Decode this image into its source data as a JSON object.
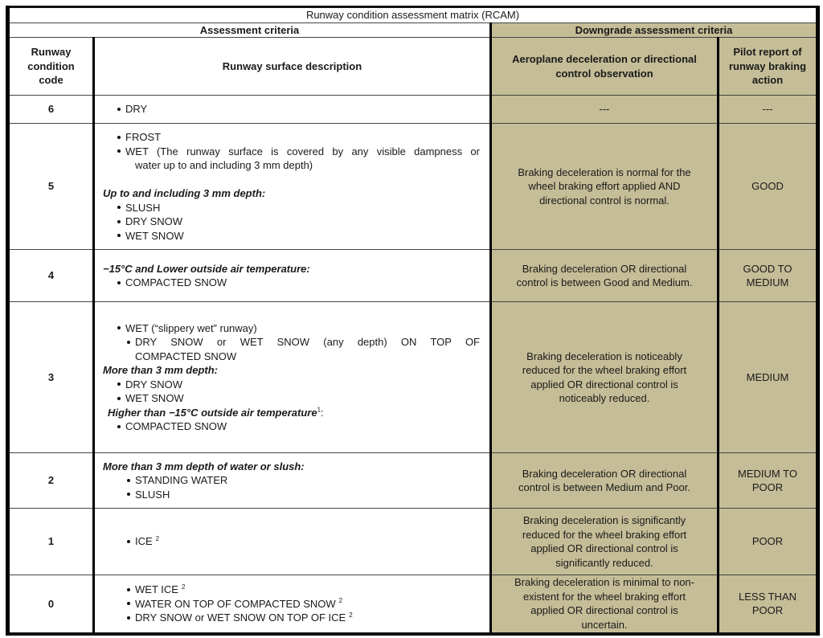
{
  "title": "Runway condition assessment matrix (RCAM)",
  "sections": {
    "assessment": "Assessment criteria",
    "downgrade": "Downgrade assessment criteria"
  },
  "columns": {
    "code": "Runway condition code",
    "description": "Runway surface description",
    "observation": "Aeroplane deceleration or directional control observation",
    "pilot_report": "Pilot report of runway braking action"
  },
  "colors": {
    "downgrade_bg": "#c5bd97",
    "border": "#000000"
  },
  "rows": [
    {
      "code": "6",
      "description": [
        {
          "type": "bullet",
          "text": "DRY"
        }
      ],
      "observation": "---",
      "pilot_report": "---"
    },
    {
      "code": "5",
      "description": [
        {
          "type": "bullet",
          "text": "FROST"
        },
        {
          "type": "bullet",
          "text": "WET (The runway surface is covered by any visible dampness or"
        },
        {
          "type": "cont",
          "text": "water up to and including 3 mm depth)"
        },
        {
          "type": "spacer",
          "text": ""
        },
        {
          "type": "heading",
          "text": "Up to and including 3 mm depth:"
        },
        {
          "type": "bullet",
          "text": "SLUSH"
        },
        {
          "type": "bullet",
          "text": "DRY SNOW"
        },
        {
          "type": "bullet",
          "text": "WET SNOW"
        }
      ],
      "observation": "Braking deceleration is normal for the wheel braking effort applied AND directional control is normal.",
      "pilot_report": "GOOD"
    },
    {
      "code": "4",
      "description": [
        {
          "type": "heading",
          "text": "−15°C and Lower outside air temperature:"
        },
        {
          "type": "bullet",
          "text": "COMPACTED SNOW"
        }
      ],
      "observation": "Braking deceleration OR directional control is between Good and Medium.",
      "pilot_report": "GOOD TO MEDIUM"
    },
    {
      "code": "3",
      "description": [
        {
          "type": "bullet",
          "text": "WET (“slippery wet” runway)"
        },
        {
          "type": "bullet",
          "text": "DRY SNOW or WET SNOW (any depth) ON TOP OF"
        },
        {
          "type": "cont",
          "text": "COMPACTED SNOW"
        },
        {
          "type": "heading",
          "text": "More than 3 mm depth:"
        },
        {
          "type": "bullet",
          "text": "DRY SNOW"
        },
        {
          "type": "bullet",
          "text": "WET SNOW"
        },
        {
          "type": "heading",
          "text": "Higher than −15°C outside air temperature",
          "sup": "1",
          "suffix": ":"
        },
        {
          "type": "bullet",
          "text": "COMPACTED SNOW"
        }
      ],
      "observation": "Braking deceleration is noticeably reduced for the wheel braking effort applied OR directional control is noticeably reduced.",
      "pilot_report": "MEDIUM"
    },
    {
      "code": "2",
      "description": [
        {
          "type": "heading",
          "text": "More than 3 mm depth of water or slush:"
        },
        {
          "type": "bullet",
          "text": "STANDING WATER"
        },
        {
          "type": "bullet",
          "text": "SLUSH"
        }
      ],
      "observation": "Braking deceleration OR directional control is between Medium and Poor.",
      "pilot_report": "MEDIUM TO POOR"
    },
    {
      "code": "1",
      "description": [
        {
          "type": "bullet",
          "text": "ICE",
          "sup": "2"
        }
      ],
      "observation": "Braking deceleration is significantly reduced for the wheel braking effort applied OR directional control is significantly reduced.",
      "pilot_report": "POOR"
    },
    {
      "code": "0",
      "description": [
        {
          "type": "bullet",
          "text": "WET ICE",
          "sup": "2"
        },
        {
          "type": "bullet",
          "text": "WATER ON TOP OF COMPACTED SNOW",
          "sup": "2"
        },
        {
          "type": "bullet",
          "text": "DRY SNOW or WET SNOW ON TOP OF ICE",
          "sup": "2"
        }
      ],
      "observation": "Braking deceleration is minimal to non-existent for the wheel braking effort applied OR directional control is uncertain.",
      "pilot_report": "LESS THAN POOR"
    }
  ]
}
